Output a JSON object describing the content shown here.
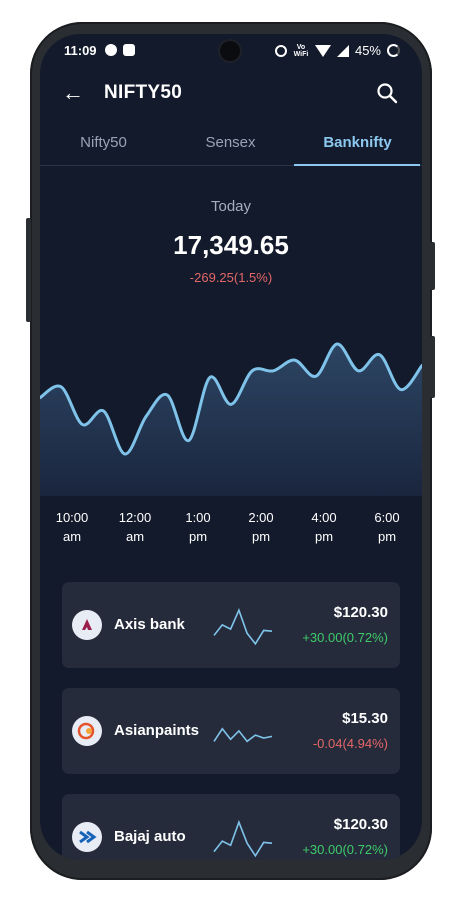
{
  "status": {
    "time": "11:09",
    "vowifi": "Vo WiFi",
    "battery": "45%"
  },
  "appbar": {
    "title": "NIFTY50"
  },
  "tabs": [
    {
      "label": "Nifty50"
    },
    {
      "label": "Sensex"
    },
    {
      "label": "Banknifty"
    }
  ],
  "summary": {
    "period": "Today",
    "value": "17,349.65",
    "change": "-269.25(1.5%)"
  },
  "time_axis": [
    {
      "t": "10:00",
      "ampm": "am"
    },
    {
      "t": "12:00",
      "ampm": "am"
    },
    {
      "t": "1:00",
      "ampm": "pm"
    },
    {
      "t": "2:00",
      "ampm": "pm"
    },
    {
      "t": "4:00",
      "ampm": "pm"
    },
    {
      "t": "6:00",
      "ampm": "pm"
    }
  ],
  "chart_data": {
    "type": "area",
    "values": [
      60,
      68,
      40,
      50,
      18,
      46,
      62,
      28,
      75,
      55,
      80,
      80,
      88,
      76,
      100,
      80,
      92,
      66,
      84
    ],
    "color": "#7fc3ea"
  },
  "stocks": [
    {
      "name": "Axis bank",
      "price": "$120.30",
      "change": "+30.00(0.72%)",
      "direction": "up",
      "spark": [
        30,
        55,
        45,
        90,
        35,
        10,
        42,
        40
      ],
      "logo": "axis-logo-icon"
    },
    {
      "name": "Asianpaints",
      "price": "$15.30",
      "change": "-0.04(4.94%)",
      "direction": "down",
      "spark": [
        30,
        60,
        35,
        55,
        30,
        45,
        38,
        42
      ],
      "logo": "asianpaints-logo-icon"
    },
    {
      "name": "Bajaj auto",
      "price": "$120.30",
      "change": "+30.00(0.72%)",
      "direction": "up",
      "spark": [
        20,
        45,
        35,
        90,
        40,
        10,
        42,
        40
      ],
      "logo": "bajaj-logo-icon"
    }
  ],
  "colors": {
    "background": "#131a2b",
    "accent": "#8cc8f0",
    "card": "#262b3b",
    "positive": "#3ecb6a",
    "negative": "#e46767"
  }
}
